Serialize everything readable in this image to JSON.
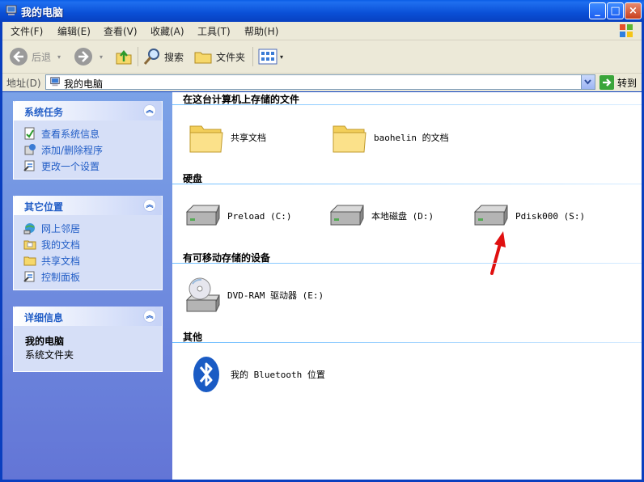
{
  "window": {
    "title": "我的电脑",
    "buttons": {
      "minimize": "_",
      "maximize": "□",
      "close": "×"
    }
  },
  "menu": [
    "文件(F)",
    "编辑(E)",
    "查看(V)",
    "收藏(A)",
    "工具(T)",
    "帮助(H)"
  ],
  "toolbar": {
    "back": "后退",
    "search": "搜索",
    "folders": "文件夹"
  },
  "address": {
    "label": "地址(D)",
    "value": "我的电脑",
    "go": "转到"
  },
  "sidebar": {
    "system_tasks": {
      "title": "系统任务",
      "items": [
        "查看系统信息",
        "添加/删除程序",
        "更改一个设置"
      ]
    },
    "other_places": {
      "title": "其它位置",
      "items": [
        "网上邻居",
        "我的文档",
        "共享文档",
        "控制面板"
      ]
    },
    "details": {
      "title": "详细信息",
      "name": "我的电脑",
      "desc": "系统文件夹"
    }
  },
  "sections": {
    "stored": {
      "title": "在这台计算机上存储的文件",
      "items": [
        "共享文档",
        "baohelin 的文档"
      ]
    },
    "disks": {
      "title": "硬盘",
      "items": [
        "Preload (C:)",
        "本地磁盘 (D:)",
        "Pdisk000 (S:)"
      ]
    },
    "removable": {
      "title": "有可移动存储的设备",
      "items": [
        "DVD-RAM 驱动器 (E:)"
      ]
    },
    "other": {
      "title": "其他",
      "items": [
        "我的 Bluetooth 位置"
      ]
    }
  },
  "colors": {
    "title_bar": "#0a4fd6",
    "sidebar": "#6f8fdf",
    "link": "#215dc6",
    "arrow": "#e01010"
  }
}
